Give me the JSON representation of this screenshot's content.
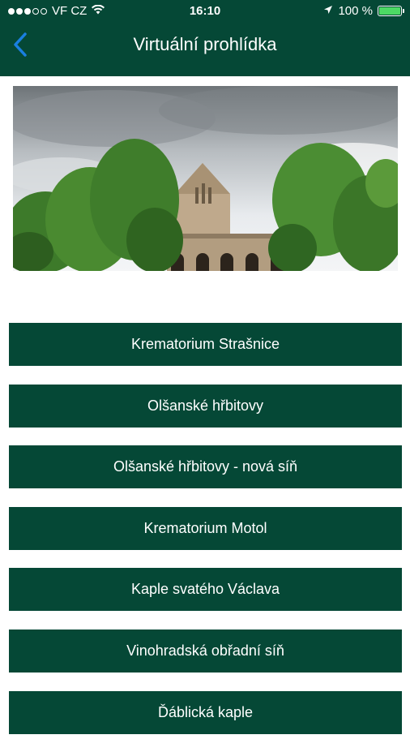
{
  "status_bar": {
    "carrier": "VF CZ",
    "time": "16:10",
    "battery": "100 %"
  },
  "nav": {
    "title": "Virtuální prohlídka",
    "back_icon": "chevron-left-icon"
  },
  "colors": {
    "primary": "#054836",
    "accent": "#1a7fe0",
    "text_on_primary": "#ffffff",
    "battery": "#4cd964"
  },
  "menu": {
    "items": [
      {
        "label": "Krematorium Strašnice"
      },
      {
        "label": "Olšanské hřbitovy"
      },
      {
        "label": "Olšanské hřbitovy - nová síň"
      },
      {
        "label": "Krematorium Motol"
      },
      {
        "label": "Kaple svatého Václava"
      },
      {
        "label": "Vinohradská obřadní síň"
      },
      {
        "label": "Ďáblická kaple"
      }
    ]
  }
}
